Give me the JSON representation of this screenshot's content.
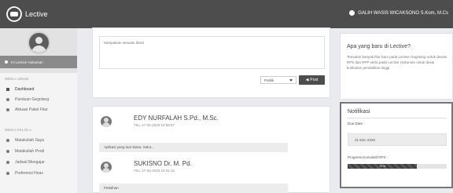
{
  "app": {
    "name": "Lective"
  },
  "user": {
    "name": "GALIH WASIS WICAKSONO S.Kom, M.Cs"
  },
  "sidebar": {
    "org": "Ini Lective Hukuman",
    "sections": [
      "MENU UMUM",
      "MENU KELOLA"
    ],
    "items": [
      {
        "label": "Dashboard",
        "icon": "home-icon",
        "active": true
      },
      {
        "label": "Panduan Gegolang",
        "icon": "book-icon"
      },
      {
        "label": "Aktuasi Paket Fitur",
        "icon": "check-icon"
      },
      {
        "label": "Matakuliah Saya",
        "icon": "list-icon"
      },
      {
        "label": "Matakuliah Prodi",
        "icon": "list-icon"
      },
      {
        "label": "Jadwal Mengajar",
        "icon": "calendar-icon"
      },
      {
        "label": "Preferensi Hoax",
        "icon": "gear-icon"
      }
    ]
  },
  "composer": {
    "placeholder": "Sampaikan sesuatu disini",
    "visibility": "Publik",
    "post_label": "Post"
  },
  "feed": [
    {
      "author": "EDY NURFALAH S.Pd., M.Sc.",
      "date": "Thu, 27-02-2020 10:58:57",
      "message": "Aplikasi yang luar biasa. Salut..."
    },
    {
      "author": "SUKISNO Dr. M. Pd.",
      "date": "Thu, 27-02-2020 10:41:15",
      "message": "Pelatihan"
    }
  ],
  "whatsnew": {
    "title": "Apa yang baru di Lective?",
    "body": "Temukan banyak fitur baru pada Lective Gegolang untuk desain RPS dan RPP serta pada Lective Hukuman untuk desai kurikulum pendidikan tinggi."
  },
  "notification": {
    "title": "Notifikasi",
    "due_label": "Due Date :",
    "due_date": "31-Dec-2020",
    "progress_label": "Progress Kumulatif RPS :",
    "progress_value": 0.7,
    "progress_text": "70 %"
  },
  "colors": {
    "topbar": "#4d4d4d",
    "accent": "#4d4d4d"
  }
}
